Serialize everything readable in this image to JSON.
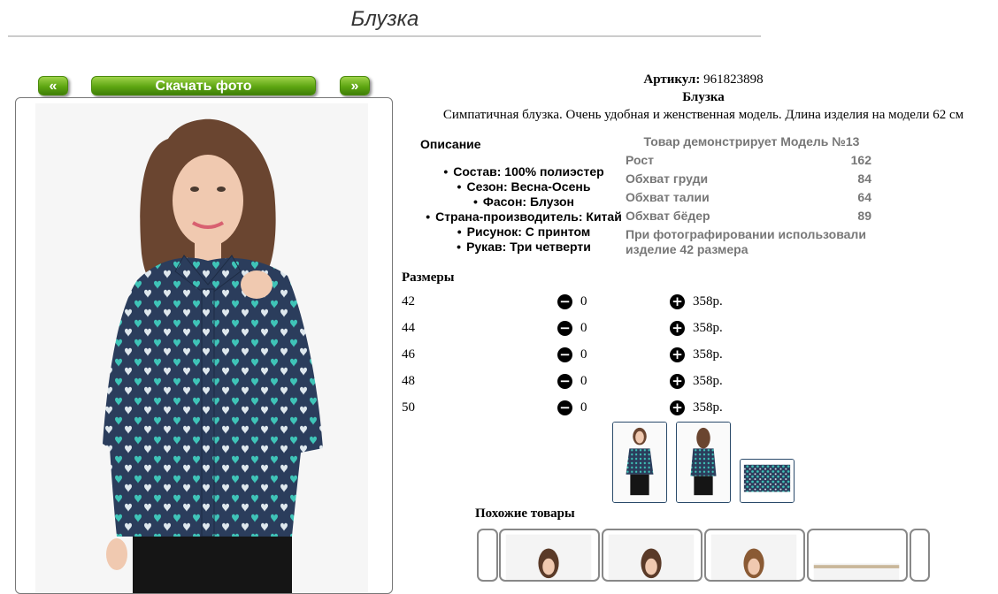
{
  "page": {
    "title": "Блузка",
    "prev_label": "«",
    "download_label": "Скачать фото",
    "next_label": "»"
  },
  "product": {
    "article_label": "Артикул:",
    "article_value": "961823898",
    "name": "Блузка",
    "short_description": "Симпатичная блузка. Очень удобная и женственная модель. Длина изделия на модели 62 см"
  },
  "description": {
    "heading": "Описание",
    "properties": [
      "Состав: 100% полиэстер",
      "Сезон: Весна-Осень",
      "Фасон: Блузон",
      "Страна-производитель: Китай",
      "Рисунок: С принтом",
      "Рукав: Три четверти"
    ]
  },
  "model": {
    "title": "Товар демонстрирует Модель №13",
    "rows": [
      {
        "label": "Рост",
        "value": "162"
      },
      {
        "label": "Обхват груди",
        "value": "84"
      },
      {
        "label": "Обхват талии",
        "value": "64"
      },
      {
        "label": "Обхват бёдер",
        "value": "89"
      }
    ],
    "note": "При фотографировании использовали изделие 42 размера"
  },
  "sizes": {
    "heading": "Размеры",
    "rows": [
      {
        "size": "42",
        "qty": "0",
        "price": "358р."
      },
      {
        "size": "44",
        "qty": "0",
        "price": "358р."
      },
      {
        "size": "46",
        "qty": "0",
        "price": "358р."
      },
      {
        "size": "48",
        "qty": "0",
        "price": "358р."
      },
      {
        "size": "50",
        "qty": "0",
        "price": "358р."
      }
    ],
    "minus_symbol": "−",
    "plus_symbol": "+"
  },
  "similar": {
    "heading": "Похожие товары"
  },
  "colors": {
    "button_green": "#5ea612",
    "print_navy": "#2b3d5c",
    "print_teal": "#3fc4b8",
    "frame_border": "#777777"
  }
}
